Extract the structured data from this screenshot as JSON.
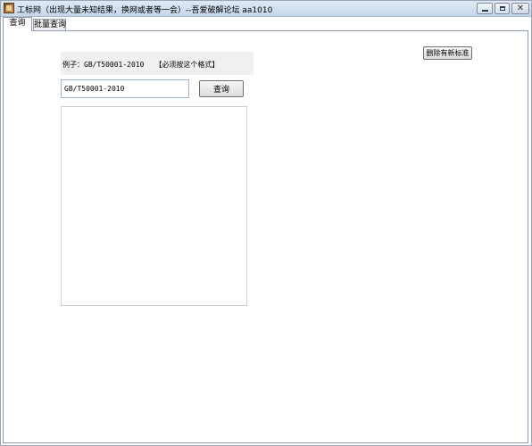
{
  "window": {
    "title": "工标网（出现大量未知结果，换网或者等一会）--吾爱破解论坛 aa1010",
    "icon": "app-icon"
  },
  "tabs": [
    {
      "label": "查询",
      "active": true
    },
    {
      "label": "批量查询",
      "active": false
    }
  ],
  "query": {
    "example_label": "例子：GB/T50001-2010",
    "example_note": "【必须按这个格式】",
    "input_value": "GB/T50001-2010",
    "search_button": "查询",
    "delete_button": "删除有新标准",
    "results_text": ""
  },
  "colors": {
    "titlebar": "#c6d6ea",
    "panel_bg": "#ffffff",
    "example_bg": "#f0f0f0",
    "input_border": "#9fb6c9"
  }
}
